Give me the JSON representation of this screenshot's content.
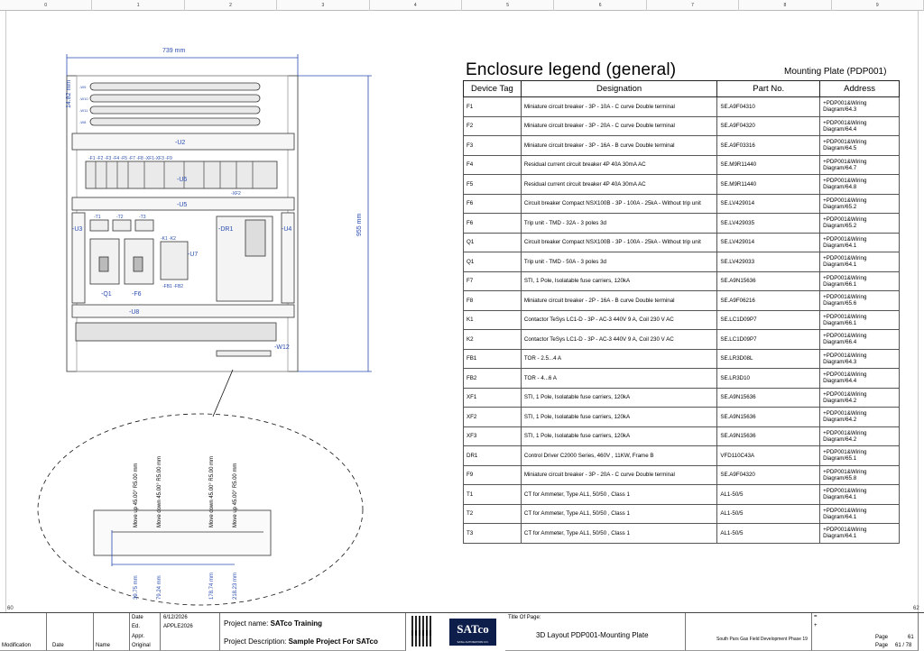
{
  "ruler": {
    "labels": [
      "0",
      "1",
      "2",
      "3",
      "4",
      "5",
      "6",
      "7",
      "8",
      "9"
    ]
  },
  "corners": {
    "left": "60",
    "right": "62"
  },
  "drawing": {
    "width_dim": "739 mm",
    "height_dim": "955 mm",
    "small_dim": "14.82 mm",
    "rail_tags": [
      "-W9",
      "-W10",
      "-W11",
      "-W8"
    ],
    "labels": {
      "u2": "-U2",
      "u3": "-U3",
      "u4": "-U4",
      "u5": "-U5",
      "u6": "-U6",
      "u7": "-U7",
      "u8": "-U8",
      "dr1": "-DR1",
      "q1": "-Q1",
      "f6": "-F6",
      "w12": "-W12",
      "fb": "-FB1 -FB2",
      "k": "-K1  -K2",
      "t1": "-T1",
      "t2": "-T2",
      "t3": "-T3",
      "top_devices": "-F1 -F2 -F3  -F4   -F5 -F7 -F8 -XF1-XF3 -F9",
      "xf2": "-XF2"
    },
    "detail_ops": [
      "Move up 45.00° R5.00 mm",
      "Move down 45.00° R5.00 mm",
      "Move down 45.00° R5.00 mm",
      "Move up 45.00° R5.00 mm"
    ],
    "detail_dims": [
      "39.75 mm",
      "79.24 mm",
      "178.74 mm",
      "218.23 mm"
    ]
  },
  "legend": {
    "title": "Enclosure legend (general)",
    "subtitle": "Mounting Plate (PDP001)",
    "headers": [
      "Device Tag",
      "Designation",
      "Part No.",
      "Address"
    ],
    "rows": [
      [
        "F1",
        "Miniature circuit breaker - 3P - 10A - C curve Double terminal",
        "SE.A9F04310",
        "+PDP001&Wiring Diagram/64.3"
      ],
      [
        "F2",
        "Miniature circuit breaker - 3P - 20A - C curve Double terminal",
        "SE.A9F04320",
        "+PDP001&Wiring Diagram/64.4"
      ],
      [
        "F3",
        "Miniature circuit breaker - 3P - 16A - B curve Double terminal",
        "SE.A9F03316",
        "+PDP001&Wiring Diagram/64.5"
      ],
      [
        "F4",
        "Residual current circuit breaker 4P 40A 30mA AC",
        "SE.M9R11440",
        "+PDP001&Wiring Diagram/64.7"
      ],
      [
        "F5",
        "Residual current circuit breaker 4P 40A 30mA AC",
        "SE.M9R11440",
        "+PDP001&Wiring Diagram/64.8"
      ],
      [
        "F6",
        "Circuit breaker Compact NSX100B - 3P - 100A - 25kA - Without trip unit",
        "SE.LV429014",
        "+PDP001&Wiring Diagram/65.2"
      ],
      [
        "F6",
        "Trip unit - TMD - 32A - 3 poles 3d",
        "SE.LV429035",
        "+PDP001&Wiring Diagram/65.2"
      ],
      [
        "Q1",
        "Circuit breaker Compact NSX100B - 3P - 100A - 25kA - Without trip unit",
        "SE.LV429014",
        "+PDP001&Wiring Diagram/64.1"
      ],
      [
        "Q1",
        "Trip unit - TMD - 50A - 3 poles 3d",
        "SE.LV429033",
        "+PDP001&Wiring Diagram/64.1"
      ],
      [
        "F7",
        "STI, 1 Pole, Isolatable fuse carriers, 120kA",
        "SE.A9N15636",
        "+PDP001&Wiring Diagram/66.1"
      ],
      [
        "F8",
        "Miniature circuit breaker - 2P - 16A - B curve Double terminal",
        "SE.A9F06216",
        "+PDP001&Wiring Diagram/65.6"
      ],
      [
        "K1",
        "Contactor TeSys LC1-D - 3P - AC-3 440V 9 A, Coil 230 V AC",
        "SE.LC1D09P7",
        "+PDP001&Wiring Diagram/66.1"
      ],
      [
        "K2",
        "Contactor TeSys LC1-D - 3P - AC-3 440V 9 A, Coil 230 V AC",
        "SE.LC1D09P7",
        "+PDP001&Wiring Diagram/66.4"
      ],
      [
        "FB1",
        "TOR - 2.5...4 A",
        "SE.LR3D08L",
        "+PDP001&Wiring Diagram/64.3"
      ],
      [
        "FB2",
        "TOR - 4...6 A",
        "SE.LR3D10",
        "+PDP001&Wiring Diagram/64.4"
      ],
      [
        "XF1",
        "STI, 1 Pole, Isolatable fuse carriers, 120kA",
        "SE.A9N15636",
        "+PDP001&Wiring Diagram/64.2"
      ],
      [
        "XF2",
        "STI, 1 Pole, Isolatable fuse carriers, 120kA",
        "SE.A9N15636",
        "+PDP001&Wiring Diagram/64.2"
      ],
      [
        "XF3",
        "STI, 1 Pole, Isolatable fuse carriers, 120kA",
        "SE.A9N15636",
        "+PDP001&Wiring Diagram/64.2"
      ],
      [
        "DR1",
        "Control Driver C2000 Series, 460V , 11KW, Frame B",
        "VFD110C43A",
        "+PDP001&Wiring Diagram/65.1"
      ],
      [
        "F9",
        "Miniature circuit breaker - 3P - 20A - C curve Double terminal",
        "SE.A9F04320",
        "+PDP001&Wiring Diagram/65.8"
      ],
      [
        "T1",
        "CT for Ammeter, Type AL1, 50/50 , Class 1",
        "AL1-50/5",
        "+PDP001&Wiring Diagram/64.1"
      ],
      [
        "T2",
        "CT for Ammeter, Type AL1, 50/50 , Class 1",
        "AL1-50/5",
        "+PDP001&Wiring Diagram/64.1"
      ],
      [
        "T3",
        "CT for Ammeter, Type AL1, 50/50 , Class 1",
        "AL1-50/5",
        "+PDP001&Wiring Diagram/64.1"
      ]
    ]
  },
  "titleblock": {
    "modification": "Modification",
    "date": "Date",
    "name": "Name",
    "date_lbl": "Date",
    "date_val": "6/12/2026",
    "ed_lbl": "Ed.",
    "ed_val": "APPLE2026",
    "appr_lbl": "Appr.",
    "original_lbl": "Original",
    "project_name_lbl": "Project name: ",
    "project_name": "SATco Training",
    "project_desc_lbl": "Project Description: ",
    "project_desc": "Sample Project For SATco",
    "logo": "SATco",
    "logo_sub": "SATco AUTOMATION CO.",
    "page_title_lbl": "Title Of Page:",
    "page_title": "3D Layout PDP001-Mounting Plate",
    "eq1": "=",
    "plus1": "+",
    "plant": "South Pars Gas Field Development Phase 19",
    "page_lbl": "Page",
    "page_num": "61",
    "page_lbl2": "Page",
    "page_of": "61 / 78"
  }
}
